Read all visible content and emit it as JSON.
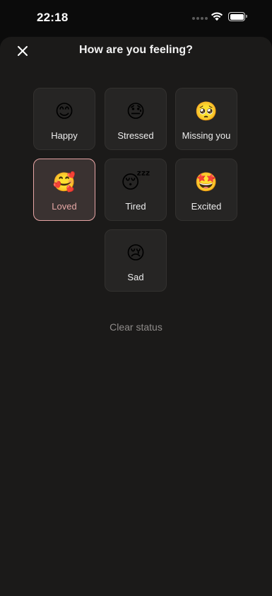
{
  "status_bar": {
    "time": "22:18"
  },
  "sheet": {
    "title": "How are you feeling?",
    "close_icon": "close-icon",
    "clear_label": "Clear status"
  },
  "moods": [
    {
      "label": "Happy",
      "emoji": "😊",
      "selected": false
    },
    {
      "label": "Stressed",
      "emoji": "😓",
      "selected": false
    },
    {
      "label": "Missing you",
      "emoji": "🥺",
      "selected": false
    },
    {
      "label": "Loved",
      "emoji": "🥰",
      "selected": true
    },
    {
      "label": "Tired",
      "emoji": "😴",
      "selected": false
    },
    {
      "label": "Excited",
      "emoji": "🤩",
      "selected": false
    },
    {
      "label": "Sad",
      "emoji": "😢",
      "selected": false
    }
  ],
  "colors": {
    "background": "#1b1a19",
    "tile": "#262524",
    "selected_border": "#e7a5a5",
    "selected_text": "#e6a7a5"
  }
}
